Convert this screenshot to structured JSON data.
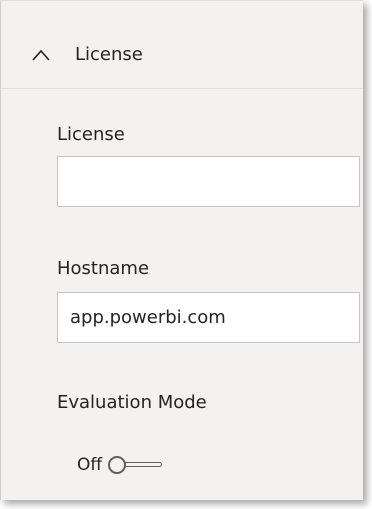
{
  "section": {
    "title": "License",
    "expanded": true
  },
  "fields": {
    "license": {
      "label": "License",
      "value": "",
      "placeholder": ""
    },
    "hostname": {
      "label": "Hostname",
      "value": "app.powerbi.com",
      "placeholder": ""
    },
    "evaluation_mode": {
      "label": "Evaluation Mode",
      "state_label": "Off",
      "checked": false
    }
  },
  "icons": {
    "collapse": "chevron-up-icon"
  },
  "colors": {
    "panel_background": "#f3f2f1",
    "input_background": "#ffffff",
    "input_border": "#c8c6c4",
    "text": "#252423",
    "toggle_outline": "#605e5c"
  }
}
